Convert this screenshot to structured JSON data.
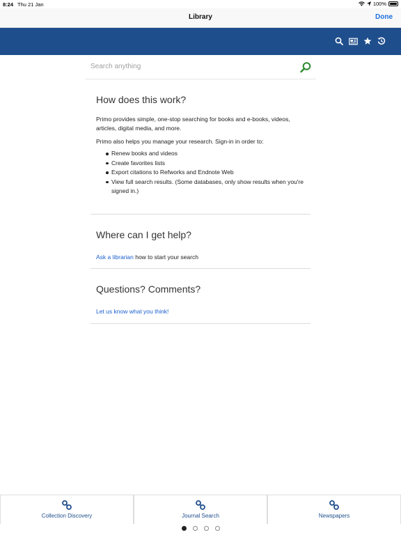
{
  "status_bar": {
    "time": "8:24",
    "date": "Thu 21 Jan",
    "battery": "100%"
  },
  "nav": {
    "title": "Library",
    "done_label": "Done"
  },
  "header_icons": [
    "search-icon",
    "newspaper-icon",
    "star-icon",
    "history-icon"
  ],
  "search": {
    "placeholder": "Search anything",
    "value": ""
  },
  "how": {
    "title": "How does this work?",
    "para1": "Primo provides simple, one-stop searching for books and e-books, videos, articles, digital media, and more.",
    "para2": "Primo also helps you manage your research. Sign-in in order to:",
    "items": [
      "Renew books and videos",
      "Create favorites lists",
      "Export citations to Refworks and Endnote Web",
      "View full search results. (Some databases, only show results when you're signed in.)"
    ]
  },
  "help": {
    "title": "Where can I get help?",
    "link": "Ask a librarian",
    "rest": " how to start your search"
  },
  "questions": {
    "title": "Questions? Comments?",
    "link": "Let us know what you think!"
  },
  "tabs": [
    {
      "label": "Collection Discovery"
    },
    {
      "label": "Journal Search"
    },
    {
      "label": "Newspapers"
    }
  ],
  "page_indicator": {
    "pages": 4,
    "current": 1
  },
  "colors": {
    "header_blue": "#1f4e8c",
    "link_blue": "#1a5fd0",
    "search_green": "#2e8b2e"
  }
}
